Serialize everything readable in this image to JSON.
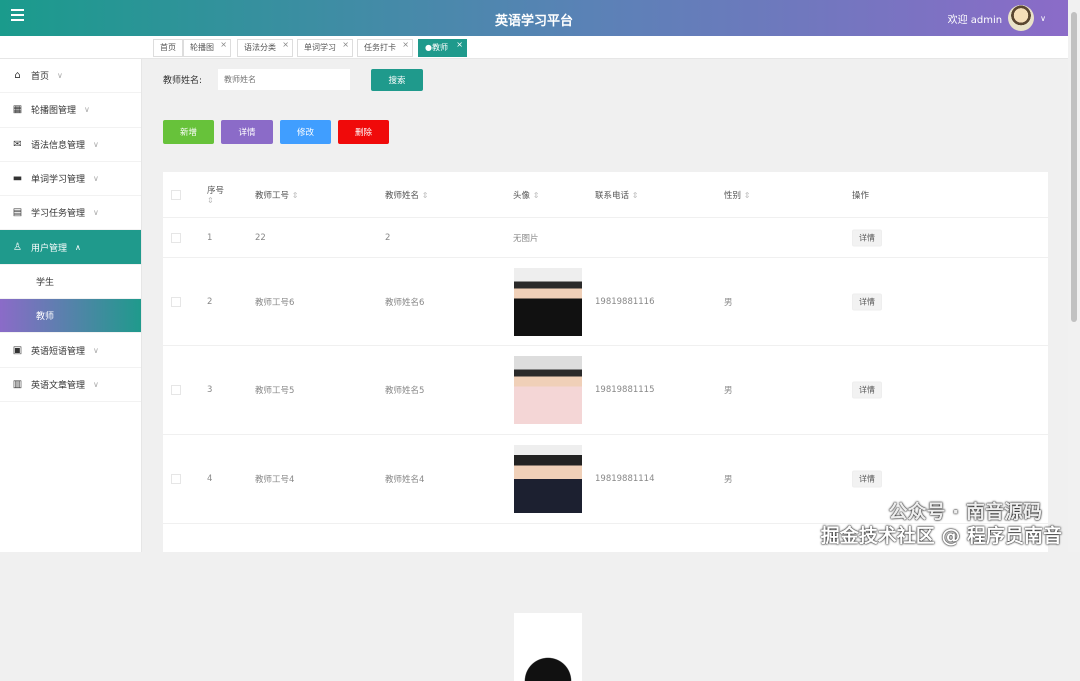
{
  "header": {
    "title": "英语学习平台",
    "welcome": "欢迎 admin"
  },
  "tabs": [
    {
      "label": "首页"
    },
    {
      "label": "轮播图"
    },
    {
      "label": "语法分类"
    },
    {
      "label": "单词学习"
    },
    {
      "label": "任务打卡"
    },
    {
      "label": "●教师"
    }
  ],
  "sidebar": {
    "items": [
      {
        "label": "首页",
        "icon": "⌂"
      },
      {
        "label": "轮播图管理",
        "icon": "▦"
      },
      {
        "label": "语法信息管理",
        "icon": "✉"
      },
      {
        "label": "单词学习管理",
        "icon": "▬"
      },
      {
        "label": "学习任务管理",
        "icon": "▤"
      },
      {
        "label": "用户管理",
        "icon": "♙"
      }
    ],
    "sub": [
      {
        "label": "学生"
      },
      {
        "label": "教师"
      }
    ],
    "items2": [
      {
        "label": "英语短语管理",
        "icon": "▣"
      },
      {
        "label": "英语文章管理",
        "icon": "▥"
      }
    ]
  },
  "search": {
    "label": "教师姓名:",
    "placeholder": "教师姓名",
    "button": "搜索"
  },
  "actions": {
    "add": "新增",
    "detail": "详情",
    "edit": "修改",
    "delete": "删除"
  },
  "table": {
    "headers": [
      "序号",
      "教师工号",
      "教师姓名",
      "头像",
      "联系电话",
      "性别",
      "操作"
    ],
    "rows": [
      {
        "no": "1",
        "id": "22",
        "name": "2",
        "avatar": "无图片",
        "phone": "",
        "gender": "",
        "op": "详情"
      },
      {
        "no": "2",
        "id": "教师工号6",
        "name": "教师姓名6",
        "avatar": "",
        "phone": "19819881116",
        "gender": "男",
        "op": "详情"
      },
      {
        "no": "3",
        "id": "教师工号5",
        "name": "教师姓名5",
        "avatar": "",
        "phone": "19819881115",
        "gender": "男",
        "op": "详情"
      },
      {
        "no": "4",
        "id": "教师工号4",
        "name": "教师姓名4",
        "avatar": "",
        "phone": "19819881114",
        "gender": "男",
        "op": "详情"
      }
    ]
  },
  "watermark": {
    "line1": "公众号 · 南音源码",
    "line2": "掘金技术社区 @ 程序员南音"
  },
  "colors": {
    "primary": "#1f9a8c",
    "purple": "#8b6bc8",
    "add": "#67c23a",
    "detail": "#8b6bc8",
    "edit": "#409eff",
    "delete": "#f00a0a"
  }
}
